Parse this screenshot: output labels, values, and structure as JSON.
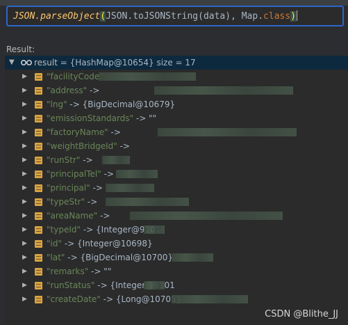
{
  "expression": {
    "method": "JSON.parseObject",
    "arg_inner": "JSON.toJSONString(data), Map.",
    "class_keyword": "class",
    "close_paren": ")"
  },
  "result_label": "Result:",
  "root": {
    "name": "result",
    "summary": " = {HashMap@10654}  size = 17"
  },
  "entries": [
    {
      "key": "\"facilityCode\"",
      "value": ""
    },
    {
      "key": "\"address\"",
      "value": " ->"
    },
    {
      "key": "\"lng\"",
      "value": " -> {BigDecimal@10679}"
    },
    {
      "key": "\"emissionStandards\"",
      "value": " -> \"\""
    },
    {
      "key": "\"factoryName\"",
      "value": " ->"
    },
    {
      "key": "\"weightBridgeId\"",
      "value": " ->"
    },
    {
      "key": "\"runStr\"",
      "value": " ->"
    },
    {
      "key": "\"principalTel\"",
      "value": " ->"
    },
    {
      "key": "\"principal\"",
      "value": " ->"
    },
    {
      "key": "\"typeStr\"",
      "value": " ->"
    },
    {
      "key": "\"areaName\"",
      "value": " ->"
    },
    {
      "key": "\"typeId\"",
      "value": " -> {Integer@9101"
    },
    {
      "key": "\"id\"",
      "value": " -> {Integer@10698}"
    },
    {
      "key": "\"lat\"",
      "value": " -> {BigDecimal@10700}"
    },
    {
      "key": "\"remarks\"",
      "value": " -> \"\""
    },
    {
      "key": "\"runStatus\"",
      "value": " -> {Integer@9101"
    },
    {
      "key": "\"createDate\"",
      "value": " -> {Long@10705}"
    }
  ],
  "watermark": "CSDN @Blithe_JJ"
}
